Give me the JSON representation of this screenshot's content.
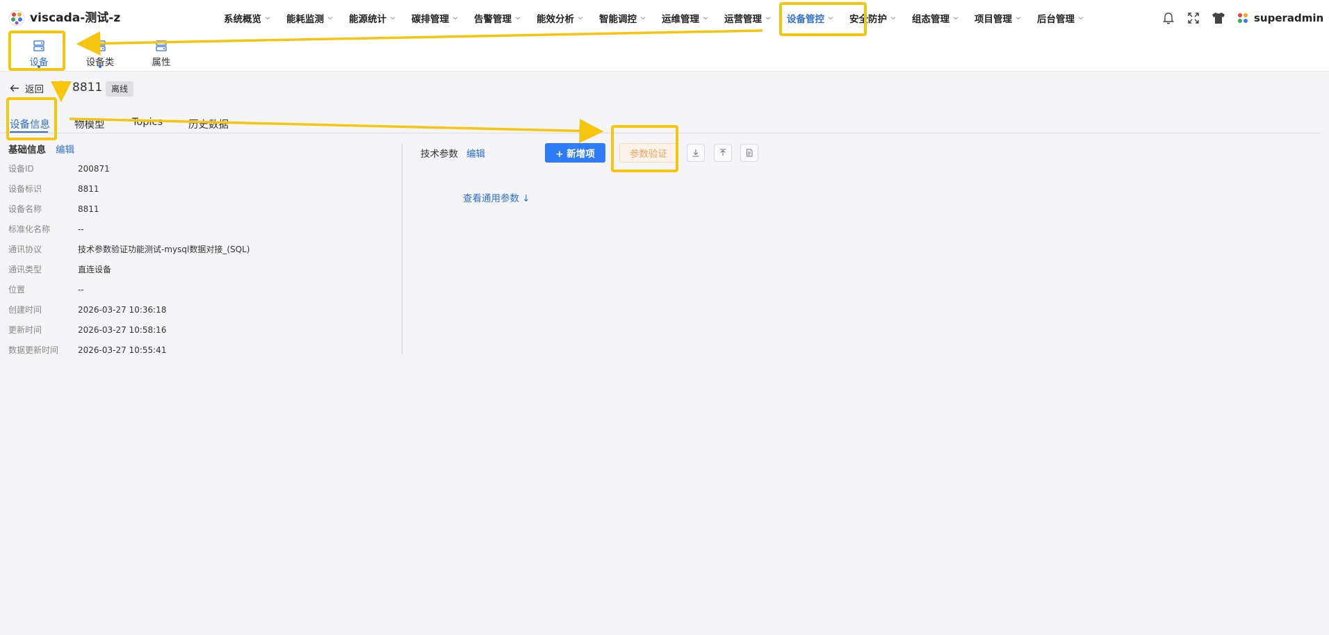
{
  "app": {
    "title": "viscada-测试-z",
    "logo_icon": "multicolor-dots-logo"
  },
  "nav": {
    "items": [
      {
        "label": "系统概览"
      },
      {
        "label": "能耗监测"
      },
      {
        "label": "能源统计"
      },
      {
        "label": "碳排管理"
      },
      {
        "label": "告警管理"
      },
      {
        "label": "能效分析"
      },
      {
        "label": "智能调控"
      },
      {
        "label": "运维管理"
      },
      {
        "label": "运营管理"
      },
      {
        "label": "设备管控",
        "active": true
      },
      {
        "label": "安全防护"
      },
      {
        "label": "组态管理"
      },
      {
        "label": "项目管理"
      },
      {
        "label": "后台管理"
      }
    ],
    "active_color": "#2f6fd6"
  },
  "header_right": {
    "icons": [
      "bell-icon",
      "fullscreen-icon",
      "tshirt-icon"
    ],
    "username": "superadmin"
  },
  "subnav": {
    "items": [
      {
        "label": "设备",
        "active": true,
        "icon": "device-icon"
      },
      {
        "label": "设备类",
        "icon": "device-class-icon"
      },
      {
        "label": "属性",
        "icon": "attribute-icon"
      }
    ]
  },
  "device": {
    "back_label": "返回",
    "name": "8811",
    "status": "离线"
  },
  "tabs": [
    {
      "label": "设备信息",
      "active": true
    },
    {
      "label": "物模型"
    },
    {
      "label": "Topics"
    },
    {
      "label": "历史数据"
    }
  ],
  "basic_info": {
    "title": "基础信息",
    "edit_label": "编辑",
    "rows": [
      {
        "label": "设备ID",
        "value": "200871"
      },
      {
        "label": "设备标识",
        "value": "8811"
      },
      {
        "label": "设备名称",
        "value": "8811"
      },
      {
        "label": "标准化名称",
        "value": "--"
      },
      {
        "label": "通讯协议",
        "value": "技术参数验证功能测试-mysql数据对接_(SQL)"
      },
      {
        "label": "通讯类型",
        "value": "直连设备"
      },
      {
        "label": "位置",
        "value": "--"
      },
      {
        "label": "创建时间",
        "value": "2026-03-27 10:36:18"
      },
      {
        "label": "更新时间",
        "value": "2026-03-27 10:58:16"
      },
      {
        "label": "数据更新时间",
        "value": "2026-03-27 10:55:41"
      }
    ]
  },
  "tech_params": {
    "title": "技术参数",
    "edit_label": "编辑",
    "add_button": "+ 新增项",
    "verify_button": "参数验证",
    "icon_buttons": [
      "download-icon",
      "upload-icon",
      "document-icon"
    ],
    "common_link": "查看通用参数 ↓"
  },
  "annotation": {
    "color": "#f6c50e"
  }
}
